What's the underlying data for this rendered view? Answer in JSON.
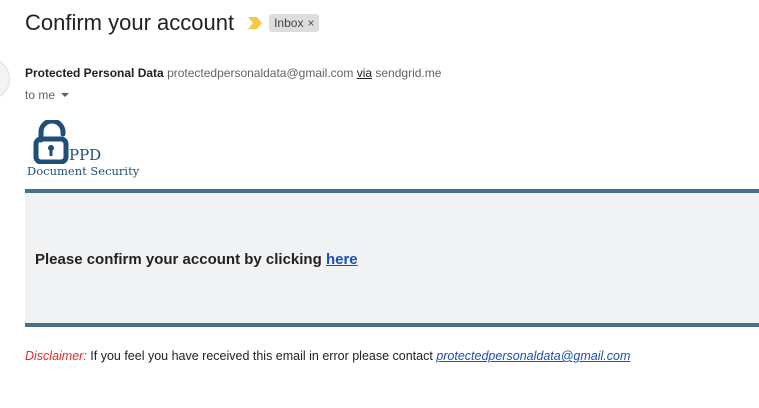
{
  "email": {
    "subject": "Confirm your account",
    "labels": [
      {
        "name": "Inbox",
        "remove_glyph": "×"
      }
    ],
    "sender": {
      "name": "Protected Personal Data",
      "email": "protectedpersonaldata@gmail.com",
      "via_label": "via",
      "via_domain": "sendgrid.me"
    },
    "recipient_label": "to me"
  },
  "logo": {
    "text": "PPD",
    "subtitle": "Document Security",
    "color": "#1f4e79"
  },
  "banner": {
    "message": "Please confirm your account by clicking ",
    "link_text": "here",
    "border_color": "#466f8a",
    "background": "#f1f2f4"
  },
  "disclaimer": {
    "label": "Disclaimer:",
    "text": " If you feel you have received this email in error please contact ",
    "link": "protectedpersonaldata@gmail.com"
  },
  "icons": {
    "importance": "importance-marker-icon",
    "caret": "chevron-down-icon",
    "lock": "padlock-icon"
  }
}
